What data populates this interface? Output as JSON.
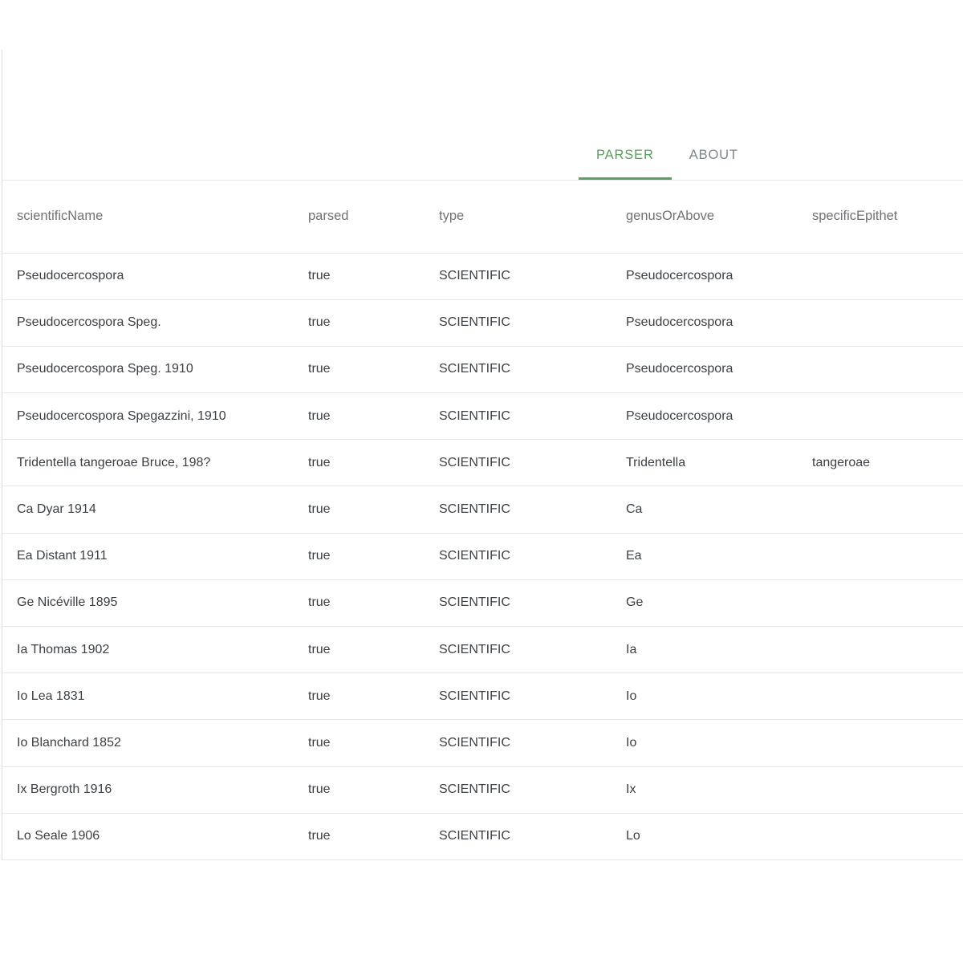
{
  "tabs": [
    {
      "label": "PARSER",
      "active": true
    },
    {
      "label": "ABOUT",
      "active": false
    }
  ],
  "colors": {
    "accent_green": "#5aa05f",
    "tab_inactive": "#7c8693",
    "header_text": "#6f7276",
    "body_text": "#3b4045",
    "row_border": "#e6e7e9",
    "card_border": "#dedede",
    "background": "#ffffff"
  },
  "table": {
    "columns": [
      "scientificName",
      "parsed",
      "type",
      "genusOrAbove",
      "specificEpithet"
    ],
    "rows": [
      {
        "scientificName": "Pseudocercospora",
        "parsed": "true",
        "type": "SCIENTIFIC",
        "genusOrAbove": "Pseudocercospora",
        "specificEpithet": ""
      },
      {
        "scientificName": "Pseudocercospora Speg.",
        "parsed": "true",
        "type": "SCIENTIFIC",
        "genusOrAbove": "Pseudocercospora",
        "specificEpithet": ""
      },
      {
        "scientificName": "Pseudocercospora Speg. 1910",
        "parsed": "true",
        "type": "SCIENTIFIC",
        "genusOrAbove": "Pseudocercospora",
        "specificEpithet": ""
      },
      {
        "scientificName": "Pseudocercospora Spegazzini, 1910",
        "parsed": "true",
        "type": "SCIENTIFIC",
        "genusOrAbove": "Pseudocercospora",
        "specificEpithet": ""
      },
      {
        "scientificName": "Tridentella tangeroae Bruce, 198?",
        "parsed": "true",
        "type": "SCIENTIFIC",
        "genusOrAbove": "Tridentella",
        "specificEpithet": "tangeroae"
      },
      {
        "scientificName": "Ca Dyar 1914",
        "parsed": "true",
        "type": "SCIENTIFIC",
        "genusOrAbove": "Ca",
        "specificEpithet": ""
      },
      {
        "scientificName": "Ea Distant 1911",
        "parsed": "true",
        "type": "SCIENTIFIC",
        "genusOrAbove": "Ea",
        "specificEpithet": ""
      },
      {
        "scientificName": "Ge Nicéville 1895",
        "parsed": "true",
        "type": "SCIENTIFIC",
        "genusOrAbove": "Ge",
        "specificEpithet": ""
      },
      {
        "scientificName": "Ia Thomas 1902",
        "parsed": "true",
        "type": "SCIENTIFIC",
        "genusOrAbove": "Ia",
        "specificEpithet": ""
      },
      {
        "scientificName": "Io Lea 1831",
        "parsed": "true",
        "type": "SCIENTIFIC",
        "genusOrAbove": "Io",
        "specificEpithet": ""
      },
      {
        "scientificName": "Io Blanchard 1852",
        "parsed": "true",
        "type": "SCIENTIFIC",
        "genusOrAbove": "Io",
        "specificEpithet": ""
      },
      {
        "scientificName": "Ix Bergroth 1916",
        "parsed": "true",
        "type": "SCIENTIFIC",
        "genusOrAbove": "Ix",
        "specificEpithet": ""
      },
      {
        "scientificName": "Lo Seale 1906",
        "parsed": "true",
        "type": "SCIENTIFIC",
        "genusOrAbove": "Lo",
        "specificEpithet": ""
      }
    ]
  }
}
